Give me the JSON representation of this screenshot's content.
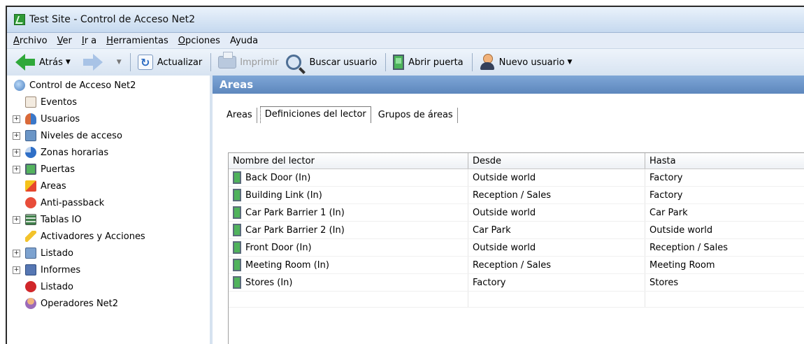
{
  "window": {
    "title": "Test Site - Control de Acceso Net2"
  },
  "menu": [
    {
      "u": "A",
      "rest": "rchivo"
    },
    {
      "u": "V",
      "rest": "er"
    },
    {
      "u": "I",
      "rest": "r a"
    },
    {
      "u": "H",
      "rest": "erramientas"
    },
    {
      "u": "O",
      "rest": "pciones"
    },
    {
      "u": "",
      "rest": "Ayuda"
    }
  ],
  "toolbar": {
    "back_label": "Atrás",
    "refresh_label": "Actualizar",
    "print_label": "Imprimir",
    "search_user_label": "Buscar usuario",
    "open_door_label": "Abrir puerta",
    "new_user_label": "Nuevo usuario"
  },
  "tree": [
    {
      "label": "Control de Acceso Net2",
      "icon": "network-icon",
      "expandable": false
    },
    {
      "label": "Eventos",
      "icon": "events-icon",
      "expandable": false
    },
    {
      "label": "Usuarios",
      "icon": "users-icon",
      "expandable": true
    },
    {
      "label": "Niveles de acceso",
      "icon": "access-levels-icon",
      "expandable": true
    },
    {
      "label": "Zonas horarias",
      "icon": "clock-icon",
      "expandable": true
    },
    {
      "label": "Puertas",
      "icon": "door-icon",
      "expandable": true
    },
    {
      "label": "Areas",
      "icon": "areas-icon",
      "expandable": false
    },
    {
      "label": "Anti-passback",
      "icon": "anti-passback-icon",
      "expandable": false
    },
    {
      "label": "Tablas IO",
      "icon": "io-tables-icon",
      "expandable": true
    },
    {
      "label": "Activadores y  Acciones",
      "icon": "lightning-icon",
      "expandable": false
    },
    {
      "label": "Listado",
      "icon": "list-icon",
      "expandable": true
    },
    {
      "label": "Informes",
      "icon": "reports-icon",
      "expandable": true
    },
    {
      "label": "Listado",
      "icon": "alert-icon",
      "expandable": false
    },
    {
      "label": "Operadores Net2",
      "icon": "operators-icon",
      "expandable": false
    }
  ],
  "section": {
    "title": "Areas"
  },
  "tabs": [
    "Areas",
    "Definiciones del lector",
    "Grupos de áreas"
  ],
  "table": {
    "headers": [
      "Nombre del lector",
      "Desde",
      "Hasta"
    ],
    "rows": [
      [
        "Back Door (In)",
        "Outside world",
        "Factory"
      ],
      [
        "Building Link (In)",
        "Reception / Sales",
        "Factory"
      ],
      [
        "Car Park Barrier 1 (In)",
        "Outside world",
        "Car Park"
      ],
      [
        "Car Park Barrier 2 (In)",
        "Car Park",
        "Outside world"
      ],
      [
        "Front Door (In)",
        "Outside world",
        "Reception / Sales"
      ],
      [
        "Meeting Room (In)",
        "Reception / Sales",
        "Meeting Room"
      ],
      [
        "Stores (In)",
        "Factory",
        "Stores"
      ]
    ]
  }
}
